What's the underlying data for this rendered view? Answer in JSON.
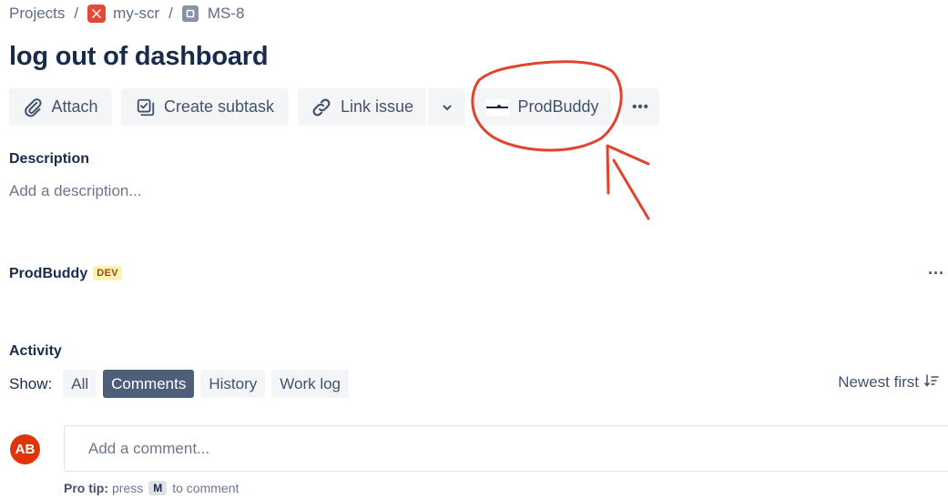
{
  "breadcrumb": {
    "root": "Projects",
    "separator": "/",
    "project": "my-scr",
    "issue_key": "MS-8"
  },
  "issue": {
    "title": "log out of dashboard"
  },
  "toolbar": {
    "attach_label": "Attach",
    "create_subtask_label": "Create subtask",
    "link_issue_label": "Link issue",
    "prodbuddy_label": "ProdBuddy",
    "more_label": "•••"
  },
  "description": {
    "heading": "Description",
    "placeholder": "Add a description..."
  },
  "prodbuddy_panel": {
    "title": "ProdBuddy",
    "badge": "DEV",
    "more_label": "···"
  },
  "activity": {
    "heading": "Activity",
    "show_label": "Show:",
    "filters": [
      {
        "label": "All",
        "active": false
      },
      {
        "label": "Comments",
        "active": true
      },
      {
        "label": "History",
        "active": false
      },
      {
        "label": "Work log",
        "active": false
      }
    ],
    "sort_label": "Newest first"
  },
  "comment": {
    "avatar_initials": "AB",
    "placeholder": "Add a comment...",
    "protip_label": "Pro tip:",
    "protip_before": "press",
    "protip_key": "M",
    "protip_after": "to comment"
  },
  "colors": {
    "text_primary": "#172b4d",
    "button_bg": "#f4f5f7",
    "active_chip": "#505f79",
    "project_icon": "#e34935",
    "avatar_bg": "#de350b",
    "dev_badge_bg": "#fff0b3",
    "annotation": "#e0442c"
  },
  "icons": {
    "attach": "paperclip-icon",
    "create_subtask": "subtask-icon",
    "link_issue": "link-icon",
    "dropdown": "chevron-down-icon",
    "sort": "sort-icon"
  }
}
